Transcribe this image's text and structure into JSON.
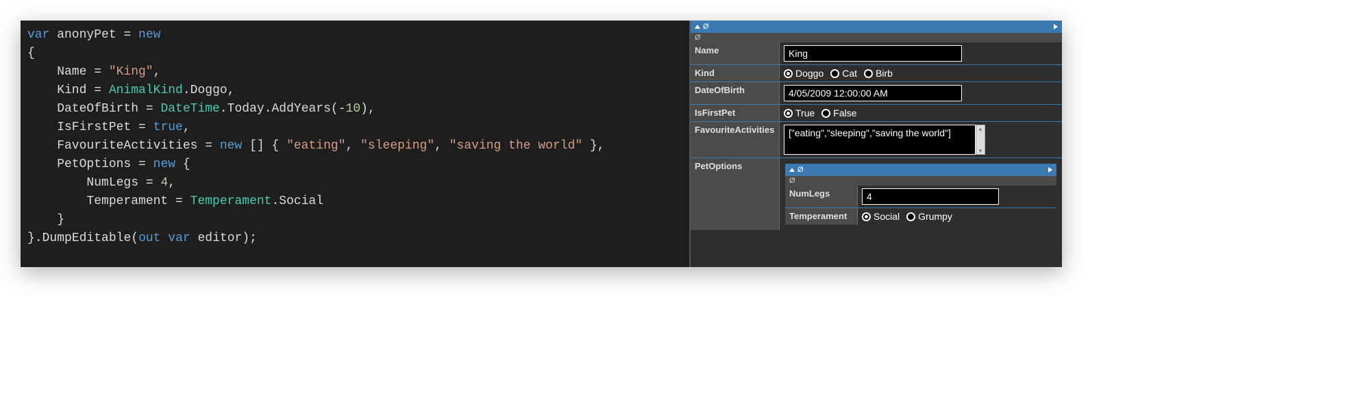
{
  "code": {
    "lines": [
      [
        [
          "kw",
          "var"
        ],
        [
          "pln",
          " anonyPet "
        ],
        [
          "op",
          "= "
        ],
        [
          "kw",
          "new"
        ]
      ],
      [
        [
          "pln",
          "{"
        ]
      ],
      [
        [
          "pln",
          "    Name "
        ],
        [
          "op",
          "= "
        ],
        [
          "str",
          "\"King\""
        ],
        [
          "op",
          ","
        ]
      ],
      [
        [
          "pln",
          "    Kind "
        ],
        [
          "op",
          "= "
        ],
        [
          "type",
          "AnimalKind"
        ],
        [
          "op",
          "."
        ],
        [
          "pln",
          "Doggo"
        ],
        [
          "op",
          ","
        ]
      ],
      [
        [
          "pln",
          "    DateOfBirth "
        ],
        [
          "op",
          "= "
        ],
        [
          "type",
          "DateTime"
        ],
        [
          "op",
          "."
        ],
        [
          "pln",
          "Today"
        ],
        [
          "op",
          "."
        ],
        [
          "pln",
          "AddYears"
        ],
        [
          "op",
          "("
        ],
        [
          "op",
          "-"
        ],
        [
          "num",
          "10"
        ],
        [
          "op",
          "),"
        ]
      ],
      [
        [
          "pln",
          "    IsFirstPet "
        ],
        [
          "op",
          "= "
        ],
        [
          "kw",
          "true"
        ],
        [
          "op",
          ","
        ]
      ],
      [
        [
          "pln",
          "    FavouriteActivities "
        ],
        [
          "op",
          "= "
        ],
        [
          "kw",
          "new"
        ],
        [
          "pln",
          " [] { "
        ],
        [
          "str",
          "\"eating\""
        ],
        [
          "op",
          ", "
        ],
        [
          "str",
          "\"sleeping\""
        ],
        [
          "op",
          ", "
        ],
        [
          "str",
          "\"saving the world\""
        ],
        [
          "pln",
          " },"
        ]
      ],
      [
        [
          "pln",
          "    PetOptions "
        ],
        [
          "op",
          "= "
        ],
        [
          "kw",
          "new"
        ],
        [
          "pln",
          " {"
        ]
      ],
      [
        [
          "pln",
          "        NumLegs "
        ],
        [
          "op",
          "= "
        ],
        [
          "num",
          "4"
        ],
        [
          "op",
          ","
        ]
      ],
      [
        [
          "pln",
          "        Temperament "
        ],
        [
          "op",
          "= "
        ],
        [
          "type",
          "Temperament"
        ],
        [
          "op",
          "."
        ],
        [
          "pln",
          "Social"
        ]
      ],
      [
        [
          "pln",
          "    }"
        ]
      ],
      [
        [
          "pln",
          "}"
        ],
        [
          "op",
          "."
        ],
        [
          "pln",
          "DumpEditable"
        ],
        [
          "op",
          "("
        ],
        [
          "kw",
          "out"
        ],
        [
          "pln",
          " "
        ],
        [
          "kw",
          "var"
        ],
        [
          "pln",
          " editor"
        ],
        [
          "op",
          ");"
        ]
      ]
    ]
  },
  "editor": {
    "headerSymbol": "Ø",
    "subheaderSymbol": "Ø",
    "fields": {
      "name": {
        "label": "Name",
        "value": "King"
      },
      "kind": {
        "label": "Kind",
        "options": [
          "Doggo",
          "Cat",
          "Birb"
        ],
        "selected": "Doggo"
      },
      "dob": {
        "label": "DateOfBirth",
        "value": "4/05/2009 12:00:00 AM"
      },
      "isFirstPet": {
        "label": "IsFirstPet",
        "options": [
          "True",
          "False"
        ],
        "selected": "True"
      },
      "favActivities": {
        "label": "FavouriteActivities",
        "value": "[\"eating\",\"sleeping\",\"saving the world\"]"
      },
      "petOptions": {
        "label": "PetOptions",
        "headerSymbol": "Ø",
        "subheaderSymbol": "Ø",
        "numLegs": {
          "label": "NumLegs",
          "value": "4"
        },
        "temperament": {
          "label": "Temperament",
          "options": [
            "Social",
            "Grumpy"
          ],
          "selected": "Social"
        }
      }
    }
  }
}
